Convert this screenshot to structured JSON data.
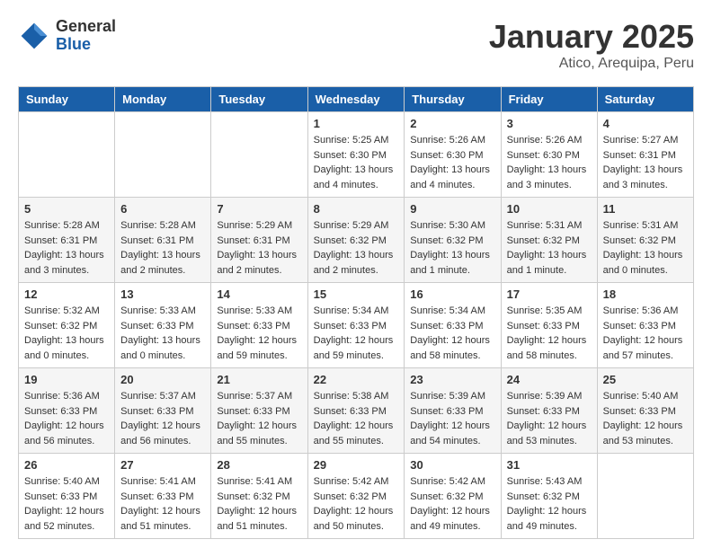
{
  "header": {
    "logo_general": "General",
    "logo_blue": "Blue",
    "title": "January 2025",
    "location": "Atico, Arequipa, Peru"
  },
  "days_of_week": [
    "Sunday",
    "Monday",
    "Tuesday",
    "Wednesday",
    "Thursday",
    "Friday",
    "Saturday"
  ],
  "weeks": [
    [
      {
        "day": "",
        "sunrise": "",
        "sunset": "",
        "daylight": ""
      },
      {
        "day": "",
        "sunrise": "",
        "sunset": "",
        "daylight": ""
      },
      {
        "day": "",
        "sunrise": "",
        "sunset": "",
        "daylight": ""
      },
      {
        "day": "1",
        "sunrise": "Sunrise: 5:25 AM",
        "sunset": "Sunset: 6:30 PM",
        "daylight": "Daylight: 13 hours and 4 minutes."
      },
      {
        "day": "2",
        "sunrise": "Sunrise: 5:26 AM",
        "sunset": "Sunset: 6:30 PM",
        "daylight": "Daylight: 13 hours and 4 minutes."
      },
      {
        "day": "3",
        "sunrise": "Sunrise: 5:26 AM",
        "sunset": "Sunset: 6:30 PM",
        "daylight": "Daylight: 13 hours and 3 minutes."
      },
      {
        "day": "4",
        "sunrise": "Sunrise: 5:27 AM",
        "sunset": "Sunset: 6:31 PM",
        "daylight": "Daylight: 13 hours and 3 minutes."
      }
    ],
    [
      {
        "day": "5",
        "sunrise": "Sunrise: 5:28 AM",
        "sunset": "Sunset: 6:31 PM",
        "daylight": "Daylight: 13 hours and 3 minutes."
      },
      {
        "day": "6",
        "sunrise": "Sunrise: 5:28 AM",
        "sunset": "Sunset: 6:31 PM",
        "daylight": "Daylight: 13 hours and 2 minutes."
      },
      {
        "day": "7",
        "sunrise": "Sunrise: 5:29 AM",
        "sunset": "Sunset: 6:31 PM",
        "daylight": "Daylight: 13 hours and 2 minutes."
      },
      {
        "day": "8",
        "sunrise": "Sunrise: 5:29 AM",
        "sunset": "Sunset: 6:32 PM",
        "daylight": "Daylight: 13 hours and 2 minutes."
      },
      {
        "day": "9",
        "sunrise": "Sunrise: 5:30 AM",
        "sunset": "Sunset: 6:32 PM",
        "daylight": "Daylight: 13 hours and 1 minute."
      },
      {
        "day": "10",
        "sunrise": "Sunrise: 5:31 AM",
        "sunset": "Sunset: 6:32 PM",
        "daylight": "Daylight: 13 hours and 1 minute."
      },
      {
        "day": "11",
        "sunrise": "Sunrise: 5:31 AM",
        "sunset": "Sunset: 6:32 PM",
        "daylight": "Daylight: 13 hours and 0 minutes."
      }
    ],
    [
      {
        "day": "12",
        "sunrise": "Sunrise: 5:32 AM",
        "sunset": "Sunset: 6:32 PM",
        "daylight": "Daylight: 13 hours and 0 minutes."
      },
      {
        "day": "13",
        "sunrise": "Sunrise: 5:33 AM",
        "sunset": "Sunset: 6:33 PM",
        "daylight": "Daylight: 13 hours and 0 minutes."
      },
      {
        "day": "14",
        "sunrise": "Sunrise: 5:33 AM",
        "sunset": "Sunset: 6:33 PM",
        "daylight": "Daylight: 12 hours and 59 minutes."
      },
      {
        "day": "15",
        "sunrise": "Sunrise: 5:34 AM",
        "sunset": "Sunset: 6:33 PM",
        "daylight": "Daylight: 12 hours and 59 minutes."
      },
      {
        "day": "16",
        "sunrise": "Sunrise: 5:34 AM",
        "sunset": "Sunset: 6:33 PM",
        "daylight": "Daylight: 12 hours and 58 minutes."
      },
      {
        "day": "17",
        "sunrise": "Sunrise: 5:35 AM",
        "sunset": "Sunset: 6:33 PM",
        "daylight": "Daylight: 12 hours and 58 minutes."
      },
      {
        "day": "18",
        "sunrise": "Sunrise: 5:36 AM",
        "sunset": "Sunset: 6:33 PM",
        "daylight": "Daylight: 12 hours and 57 minutes."
      }
    ],
    [
      {
        "day": "19",
        "sunrise": "Sunrise: 5:36 AM",
        "sunset": "Sunset: 6:33 PM",
        "daylight": "Daylight: 12 hours and 56 minutes."
      },
      {
        "day": "20",
        "sunrise": "Sunrise: 5:37 AM",
        "sunset": "Sunset: 6:33 PM",
        "daylight": "Daylight: 12 hours and 56 minutes."
      },
      {
        "day": "21",
        "sunrise": "Sunrise: 5:37 AM",
        "sunset": "Sunset: 6:33 PM",
        "daylight": "Daylight: 12 hours and 55 minutes."
      },
      {
        "day": "22",
        "sunrise": "Sunrise: 5:38 AM",
        "sunset": "Sunset: 6:33 PM",
        "daylight": "Daylight: 12 hours and 55 minutes."
      },
      {
        "day": "23",
        "sunrise": "Sunrise: 5:39 AM",
        "sunset": "Sunset: 6:33 PM",
        "daylight": "Daylight: 12 hours and 54 minutes."
      },
      {
        "day": "24",
        "sunrise": "Sunrise: 5:39 AM",
        "sunset": "Sunset: 6:33 PM",
        "daylight": "Daylight: 12 hours and 53 minutes."
      },
      {
        "day": "25",
        "sunrise": "Sunrise: 5:40 AM",
        "sunset": "Sunset: 6:33 PM",
        "daylight": "Daylight: 12 hours and 53 minutes."
      }
    ],
    [
      {
        "day": "26",
        "sunrise": "Sunrise: 5:40 AM",
        "sunset": "Sunset: 6:33 PM",
        "daylight": "Daylight: 12 hours and 52 minutes."
      },
      {
        "day": "27",
        "sunrise": "Sunrise: 5:41 AM",
        "sunset": "Sunset: 6:33 PM",
        "daylight": "Daylight: 12 hours and 51 minutes."
      },
      {
        "day": "28",
        "sunrise": "Sunrise: 5:41 AM",
        "sunset": "Sunset: 6:32 PM",
        "daylight": "Daylight: 12 hours and 51 minutes."
      },
      {
        "day": "29",
        "sunrise": "Sunrise: 5:42 AM",
        "sunset": "Sunset: 6:32 PM",
        "daylight": "Daylight: 12 hours and 50 minutes."
      },
      {
        "day": "30",
        "sunrise": "Sunrise: 5:42 AM",
        "sunset": "Sunset: 6:32 PM",
        "daylight": "Daylight: 12 hours and 49 minutes."
      },
      {
        "day": "31",
        "sunrise": "Sunrise: 5:43 AM",
        "sunset": "Sunset: 6:32 PM",
        "daylight": "Daylight: 12 hours and 49 minutes."
      },
      {
        "day": "",
        "sunrise": "",
        "sunset": "",
        "daylight": ""
      }
    ]
  ]
}
